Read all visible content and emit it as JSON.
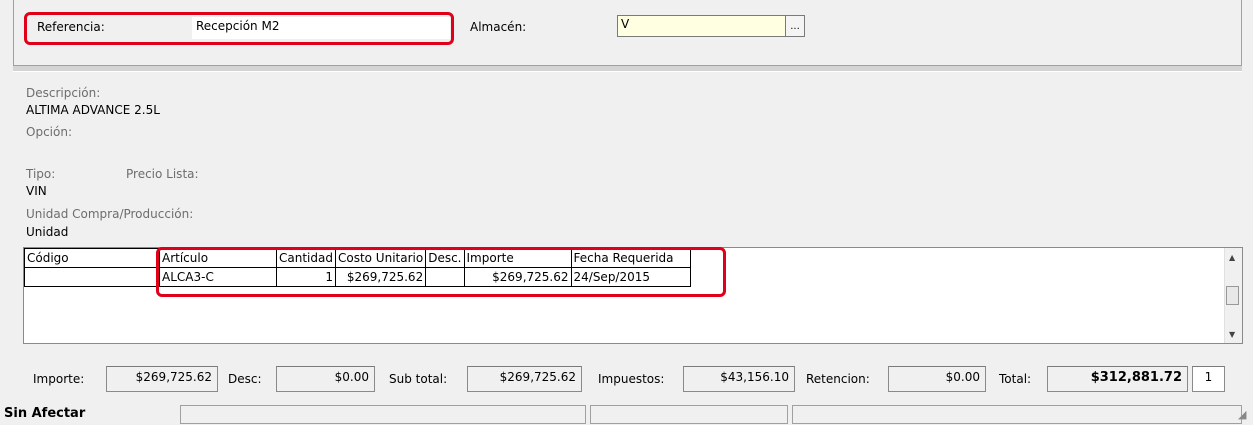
{
  "header": {
    "referencia_label": "Referencia:",
    "referencia_value": "Recepción M2",
    "almacen_label": "Almacén:",
    "almacen_value": "V",
    "almacen_button": "..."
  },
  "details": {
    "descripcion_label": "Descripción:",
    "descripcion_value": "ALTIMA ADVANCE 2.5L",
    "opcion_label": "Opción:",
    "tipo_label": "Tipo:",
    "precio_lista_label": "Precio Lista:",
    "tipo_value": "VIN",
    "unidad_label": "Unidad Compra/Producción:",
    "unidad_value": "Unidad"
  },
  "grid": {
    "columns": [
      "Código",
      "Artículo",
      "Cantidad",
      "Costo Unitario",
      "Desc.",
      "Importe",
      "Fecha Requerida"
    ],
    "rows": [
      [
        "",
        "ALCA3-C",
        "1",
        "$269,725.62",
        "",
        "$269,725.62",
        "24/Sep/2015"
      ]
    ]
  },
  "totals": {
    "importe_label": "Importe:",
    "importe_value": "$269,725.62",
    "desc_label": "Desc:",
    "desc_value": "$0.00",
    "subtotal_label": "Sub total:",
    "subtotal_value": "$269,725.62",
    "impuestos_label": "Impuestos:",
    "impuestos_value": "$43,156.10",
    "retencion_label": "Retencion:",
    "retencion_value": "$0.00",
    "total_label": "Total:",
    "total_value": "$312,881.72",
    "count_value": "1"
  },
  "status": {
    "state": "Sin Afectar"
  },
  "colors": {
    "highlight": "#e0001a",
    "almacen_bg": "#ffffe1"
  }
}
